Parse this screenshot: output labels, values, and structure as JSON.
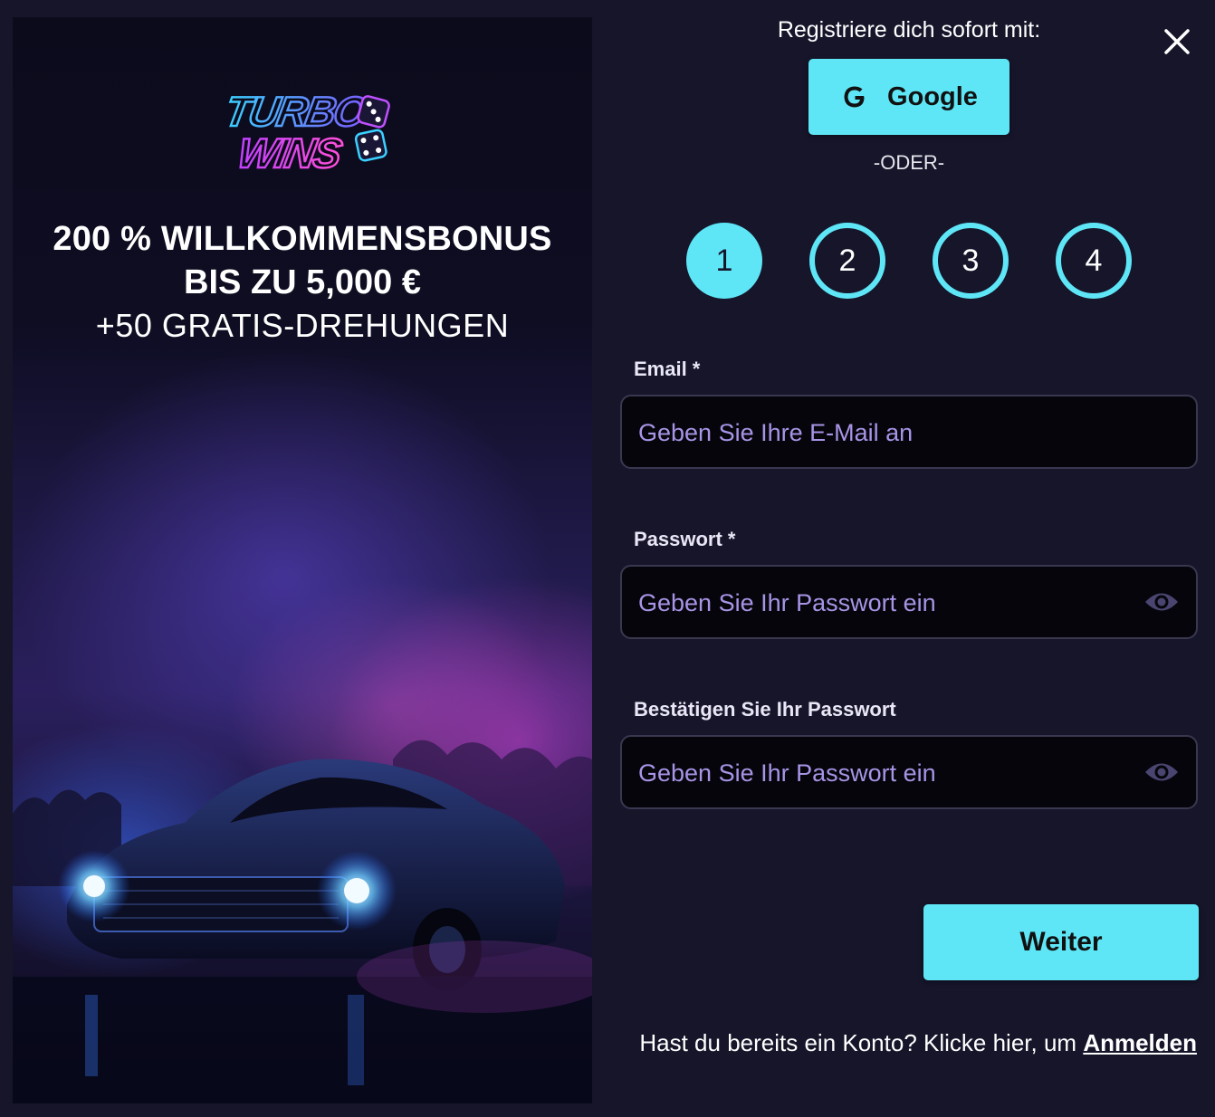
{
  "promo": {
    "logo_alt": "TURBO WINS",
    "bonus_line_1": "200 % WILLKOMMENSBONUS",
    "bonus_line_2": "BIS ZU 5,000 €",
    "bonus_line_3": "+50 GRATIS-DREHUNGEN"
  },
  "signup": {
    "heading": "Registriere dich sofort mit:",
    "google_label": "Google",
    "divider": "-ODER-"
  },
  "steps": [
    {
      "label": "1",
      "active": true
    },
    {
      "label": "2",
      "active": false
    },
    {
      "label": "3",
      "active": false
    },
    {
      "label": "4",
      "active": false
    }
  ],
  "form": {
    "email": {
      "label": "Email *",
      "placeholder": "Geben Sie Ihre E-Mail an",
      "value": ""
    },
    "password": {
      "label": "Passwort *",
      "placeholder": "Geben Sie Ihr Passwort ein",
      "value": ""
    },
    "confirm_password": {
      "label": "Bestätigen Sie Ihr Passwort",
      "placeholder": "Geben Sie Ihr Passwort ein",
      "value": ""
    }
  },
  "actions": {
    "next_label": "Weiter",
    "login_prompt": "Hast du bereits ein Konto? Klicke hier, um ",
    "login_link": "Anmelden"
  },
  "icons": {
    "close": "close-icon",
    "google": "google-icon",
    "eye": "eye-icon"
  },
  "colors": {
    "background": "#16152a",
    "accent": "#5ee6f7",
    "input_bg": "#05050b",
    "placeholder": "#a894e6"
  }
}
